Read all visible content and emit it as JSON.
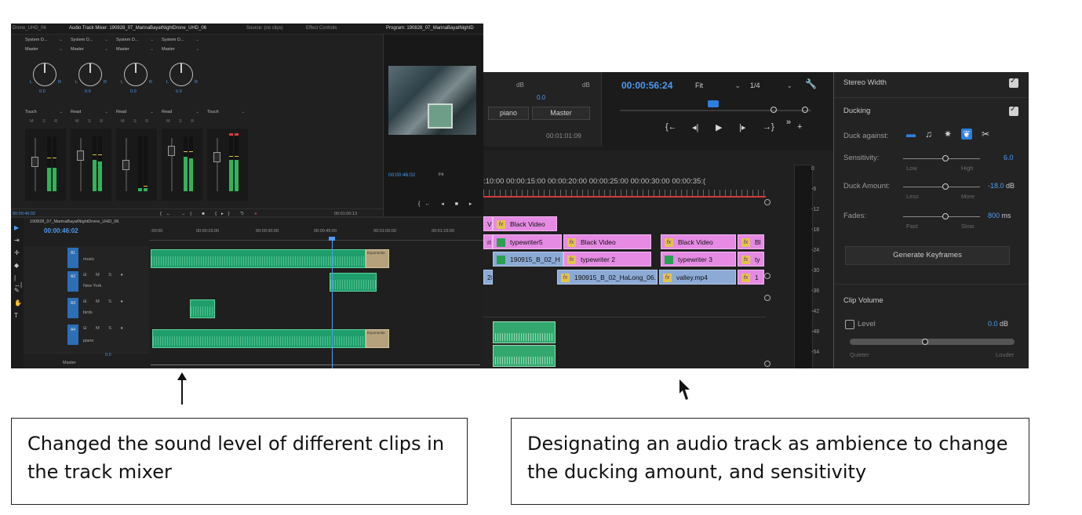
{
  "left_screenshot": {
    "tabs": {
      "seq_short": "Drone_UHD_06",
      "audio_mixer": "Audio Track Mixer: 190828_07_MarinaBayatNightDrone_UHD_06",
      "source": "Source: (no clips)",
      "effect_controls": "Effect Controls",
      "program": "Program: 190828_07_MarinaBayatNightD"
    },
    "mixer": {
      "strips": [
        {
          "routing": "System D...",
          "output": "Master",
          "pan": "0.0",
          "automation": "Touch"
        },
        {
          "routing": "System D...",
          "output": "Master",
          "pan": "0.0",
          "automation": "Read"
        },
        {
          "routing": "System D...",
          "output": "Master",
          "pan": "0.0",
          "automation": "Read"
        },
        {
          "routing": "System D...",
          "output": "Master",
          "pan": "0.0",
          "automation": "Read"
        },
        {
          "routing": "",
          "output": "",
          "pan": "",
          "automation": "Touch"
        }
      ],
      "pan_l": "L",
      "pan_r": "R",
      "msr": "M S R",
      "footer_time_left": "00:00:46:02",
      "footer_time_right": "00:01:00:13"
    },
    "program_mini": {
      "timecode": "00:00:46:02",
      "fit": "Fit"
    },
    "timeline": {
      "sequence_name": "190828_07_MarinaBayatNightDrone_UHD_06",
      "timecode": "00:00:46:02",
      "ruler": [
        ":00:00",
        "00:00:15:00",
        "00:00:30:00",
        "00:00:45:00",
        "00:01:00:00",
        "00:01:15:00"
      ],
      "tracks": [
        {
          "id": "A1",
          "name": "music"
        },
        {
          "id": "A2",
          "name": "New York"
        },
        {
          "id": "A3",
          "name": "birds"
        },
        {
          "id": "A4",
          "name": "piano"
        }
      ],
      "master_label": "Master",
      "master_value": "0.0",
      "exponential_label": "Exponentia"
    }
  },
  "right_screenshot": {
    "mini_mixer": {
      "db": "dB",
      "pan_value": "0.0",
      "track_name": "piano",
      "master_name": "Master",
      "time": "00:01:01:09"
    },
    "program": {
      "timecode": "00:00:56:24",
      "fit": "Fit",
      "quality": "1/4"
    },
    "ruler": ":10:00   00:00:15:00   00:00:20:00   00:00:25:00   00:00:30:00   00:00:35:(",
    "clips_row1": [
      {
        "label": "V",
        "kind": "pink"
      },
      {
        "label": "Black Video",
        "kind": "pink-fx"
      }
    ],
    "clips_row2": [
      {
        "label": "ri",
        "kind": "pink"
      },
      {
        "label": "typewriter5",
        "kind": "pink-gfx"
      },
      {
        "label": "Black Video",
        "kind": "pink-fx"
      },
      {
        "label": "Black Video",
        "kind": "pink-fx"
      },
      {
        "label": "Bl",
        "kind": "pink-fx"
      }
    ],
    "clips_row3": [
      {
        "label": "190915_B_02_H",
        "kind": "blue-gfx"
      },
      {
        "label": "typewriter 2",
        "kind": "pink-fx"
      },
      {
        "label": "typewriter 3",
        "kind": "pink-gfx"
      },
      {
        "label": "ty",
        "kind": "pink-fx"
      }
    ],
    "clips_row4": [
      {
        "label": "28",
        "kind": "blue"
      },
      {
        "label": "190915_B_02_HaLong_06.",
        "kind": "blue-fx"
      },
      {
        "label": "valley.mp4",
        "kind": "blue-fx"
      },
      {
        "label": "1",
        "kind": "pink-fx"
      }
    ],
    "meter_scale": [
      "0",
      "-6",
      "-12",
      "-18",
      "-24",
      "-30",
      "-36",
      "-42",
      "-48",
      "-54"
    ],
    "essential_sound": {
      "stereo_width": "Stereo Width",
      "ducking": "Ducking",
      "duck_against": "Duck against:",
      "sensitivity_label": "Sensitivity:",
      "sensitivity_low": "Low",
      "sensitivity_high": "High",
      "sensitivity_value": "6.0",
      "duck_amount_label": "Duck Amount:",
      "duck_amount_less": "Less",
      "duck_amount_more": "More",
      "duck_amount_value": "-18.0",
      "duck_amount_unit": "dB",
      "fades_label": "Fades:",
      "fades_fast": "Fast",
      "fades_slow": "Slow",
      "fades_value": "800",
      "fades_unit": "ms",
      "generate_keyframes": "Generate Keyframes",
      "clip_volume": "Clip Volume",
      "level_label": "Level",
      "level_value": "0.0",
      "level_unit": "dB",
      "quieter": "Quieter",
      "louder": "Louder"
    }
  },
  "captions": {
    "left": "Changed the sound level of different clips in the track mixer",
    "right": "Designating an audio track as ambience to change the ducking amount, and sensitivity"
  },
  "colors": {
    "accent_blue": "#4d9bf0",
    "clip_pink": "#e58be4",
    "clip_blue": "#8caad6",
    "audio_green": "#1f9e6b"
  }
}
